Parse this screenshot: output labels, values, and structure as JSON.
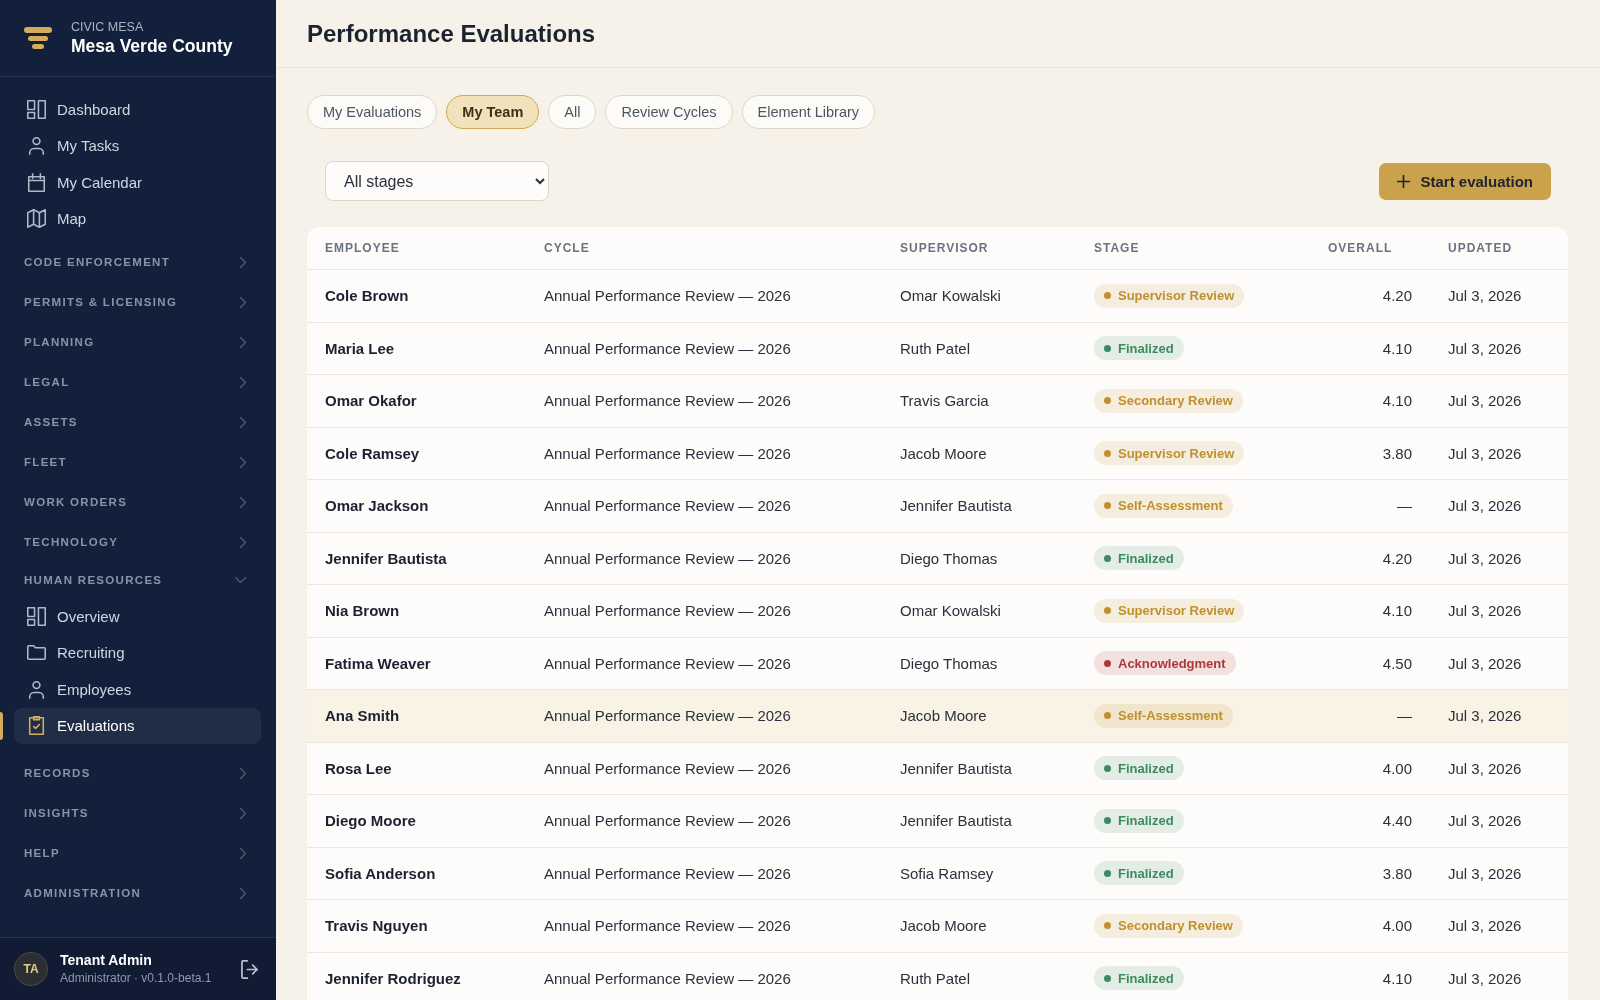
{
  "sidebar": {
    "brand": {
      "eyebrow": "CIVIC MESA",
      "name": "Mesa Verde County"
    },
    "items": [
      {
        "label": "Dashboard",
        "kind": "grid",
        "selected": false
      },
      {
        "label": "My Tasks",
        "kind": "person",
        "selected": false
      },
      {
        "label": "My Calendar",
        "kind": "calendar",
        "selected": false
      },
      {
        "label": "Map",
        "kind": "map",
        "selected": false
      }
    ],
    "sections": [
      {
        "label": "CODE ENFORCEMENT",
        "expanded": false
      },
      {
        "label": "PERMITS & LICENSING",
        "expanded": false
      },
      {
        "label": "PLANNING",
        "expanded": false
      },
      {
        "label": "LEGAL",
        "expanded": false
      },
      {
        "label": "ASSETS",
        "expanded": false
      },
      {
        "label": "FLEET",
        "expanded": false
      },
      {
        "label": "WORK ORDERS",
        "expanded": false
      },
      {
        "label": "TECHNOLOGY",
        "expanded": false
      },
      {
        "label": "HUMAN RESOURCES",
        "expanded": true,
        "children": [
          {
            "label": "Overview",
            "kind": "grid",
            "selected": false
          },
          {
            "label": "Recruiting",
            "kind": "folder",
            "selected": false
          },
          {
            "label": "Employees",
            "kind": "person",
            "selected": false
          },
          {
            "label": "Evaluations",
            "kind": "clipboard",
            "selected": true
          }
        ]
      },
      {
        "label": "RECORDS",
        "expanded": false
      },
      {
        "label": "INSIGHTS",
        "expanded": false
      },
      {
        "label": "HELP",
        "expanded": false
      },
      {
        "label": "ADMINISTRATION",
        "expanded": false
      }
    ],
    "user": {
      "initials": "TA",
      "name": "Tenant Admin",
      "role": "Administrator · v0.1.0-beta.1"
    }
  },
  "header": {
    "title": "Performance Evaluations"
  },
  "tabs": [
    {
      "label": "My Evaluations",
      "selected": false
    },
    {
      "label": "My Team",
      "selected": true
    },
    {
      "label": "All",
      "selected": false
    },
    {
      "label": "Review Cycles",
      "selected": false
    },
    {
      "label": "Element Library",
      "selected": false
    }
  ],
  "toolbar": {
    "stage_filter": {
      "value": "All stages"
    },
    "start_button": {
      "label": "Start evaluation"
    }
  },
  "table": {
    "columns": [
      "EMPLOYEE",
      "CYCLE",
      "SUPERVISOR",
      "STAGE",
      "OVERALL",
      "UPDATED"
    ],
    "rows": [
      {
        "employee": "Cole Brown",
        "cycle": "Annual Performance Review — 2026",
        "supervisor": "Omar Kowalski",
        "stage": {
          "label": "Supervisor Review",
          "color": "#c0902f"
        },
        "overall": "4.20",
        "updated": "Jul 3, 2026",
        "selected": false
      },
      {
        "employee": "Maria Lee",
        "cycle": "Annual Performance Review — 2026",
        "supervisor": "Ruth Patel",
        "stage": {
          "label": "Finalized",
          "color": "#3b8a60"
        },
        "overall": "4.10",
        "updated": "Jul 3, 2026",
        "selected": false
      },
      {
        "employee": "Omar Okafor",
        "cycle": "Annual Performance Review — 2026",
        "supervisor": "Travis Garcia",
        "stage": {
          "label": "Secondary Review",
          "color": "#c0902f"
        },
        "overall": "4.10",
        "updated": "Jul 3, 2026",
        "selected": false
      },
      {
        "employee": "Cole Ramsey",
        "cycle": "Annual Performance Review — 2026",
        "supervisor": "Jacob Moore",
        "stage": {
          "label": "Supervisor Review",
          "color": "#c0902f"
        },
        "overall": "3.80",
        "updated": "Jul 3, 2026",
        "selected": false
      },
      {
        "employee": "Omar Jackson",
        "cycle": "Annual Performance Review — 2026",
        "supervisor": "Jennifer Bautista",
        "stage": {
          "label": "Self-Assessment",
          "color": "#c0902f"
        },
        "overall": "—",
        "updated": "Jul 3, 2026",
        "selected": false
      },
      {
        "employee": "Jennifer Bautista",
        "cycle": "Annual Performance Review — 2026",
        "supervisor": "Diego Thomas",
        "stage": {
          "label": "Finalized",
          "color": "#3b8a60"
        },
        "overall": "4.20",
        "updated": "Jul 3, 2026",
        "selected": false
      },
      {
        "employee": "Nia Brown",
        "cycle": "Annual Performance Review — 2026",
        "supervisor": "Omar Kowalski",
        "stage": {
          "label": "Supervisor Review",
          "color": "#c0902f"
        },
        "overall": "4.10",
        "updated": "Jul 3, 2026",
        "selected": false
      },
      {
        "employee": "Fatima Weaver",
        "cycle": "Annual Performance Review — 2026",
        "supervisor": "Diego Thomas",
        "stage": {
          "label": "Acknowledgment",
          "color": "#ad3838"
        },
        "overall": "4.50",
        "updated": "Jul 3, 2026",
        "selected": false
      },
      {
        "employee": "Ana Smith",
        "cycle": "Annual Performance Review — 2026",
        "supervisor": "Jacob Moore",
        "stage": {
          "label": "Self-Assessment",
          "color": "#c0902f"
        },
        "overall": "—",
        "updated": "Jul 3, 2026",
        "selected": true
      },
      {
        "employee": "Rosa Lee",
        "cycle": "Annual Performance Review — 2026",
        "supervisor": "Jennifer Bautista",
        "stage": {
          "label": "Finalized",
          "color": "#3b8a60"
        },
        "overall": "4.00",
        "updated": "Jul 3, 2026",
        "selected": false
      },
      {
        "employee": "Diego Moore",
        "cycle": "Annual Performance Review — 2026",
        "supervisor": "Jennifer Bautista",
        "stage": {
          "label": "Finalized",
          "color": "#3b8a60"
        },
        "overall": "4.40",
        "updated": "Jul 3, 2026",
        "selected": false
      },
      {
        "employee": "Sofia Anderson",
        "cycle": "Annual Performance Review — 2026",
        "supervisor": "Sofia Ramsey",
        "stage": {
          "label": "Finalized",
          "color": "#3b8a60"
        },
        "overall": "3.80",
        "updated": "Jul 3, 2026",
        "selected": false
      },
      {
        "employee": "Travis Nguyen",
        "cycle": "Annual Performance Review — 2026",
        "supervisor": "Jacob Moore",
        "stage": {
          "label": "Secondary Review",
          "color": "#c0902f"
        },
        "overall": "4.00",
        "updated": "Jul 3, 2026",
        "selected": false
      },
      {
        "employee": "Jennifer Rodriguez",
        "cycle": "Annual Performance Review — 2026",
        "supervisor": "Ruth Patel",
        "stage": {
          "label": "Finalized",
          "color": "#3b8a60"
        },
        "overall": "4.10",
        "updated": "Jul 3, 2026",
        "selected": false
      }
    ]
  }
}
